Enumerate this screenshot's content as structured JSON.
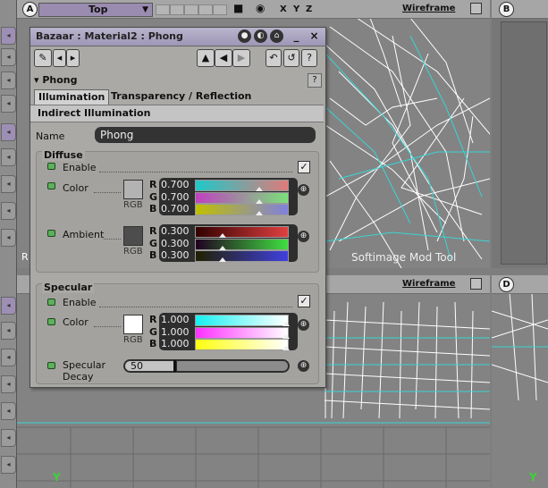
{
  "viewport_a": {
    "letter": "A",
    "view_menu": "Top",
    "axes": [
      "X",
      "Y",
      "Z"
    ],
    "display_mode": "Wireframe",
    "overlay_text": "Softimage  Mod  Tool",
    "corner_label": "R"
  },
  "viewport_b": {
    "letter": "B"
  },
  "viewport_c": {
    "display_mode": "Wireframe",
    "axis_y": "Y"
  },
  "viewport_d": {
    "letter": "D",
    "axis_y": "Y"
  },
  "panel": {
    "title": "Bazaar : Material2 : Phong",
    "close": "×",
    "help": "?",
    "section": "Phong",
    "tabs": [
      "Illumination",
      "Transparency / Reflection"
    ],
    "subtab": "Indirect Illumination",
    "name_label": "Name",
    "name_value": "Phong",
    "rgb_label": "RGB",
    "diffuse": {
      "title": "Diffuse",
      "enable_label": "Enable",
      "enabled": true,
      "color": {
        "label": "Color",
        "swatch": "#b3b3b3",
        "r": "0.700",
        "g": "0.700",
        "b": "0.700",
        "r_level": 0.7,
        "g_level": 0.7,
        "b_level": 0.7
      },
      "ambient": {
        "label": "Ambient",
        "swatch": "#4d4d4d",
        "r": "0.300",
        "g": "0.300",
        "b": "0.300",
        "r_level": 0.3,
        "g_level": 0.3,
        "b_level": 0.3
      }
    },
    "specular": {
      "title": "Specular",
      "enable_label": "Enable",
      "enabled": true,
      "color": {
        "label": "Color",
        "swatch": "#ffffff",
        "r": "1.000",
        "g": "1.000",
        "b": "1.000",
        "r_level": 1.0,
        "g_level": 1.0,
        "b_level": 1.0
      },
      "decay_label_1": "Specular",
      "decay_label_2": "Decay",
      "decay_value": "50"
    }
  }
}
